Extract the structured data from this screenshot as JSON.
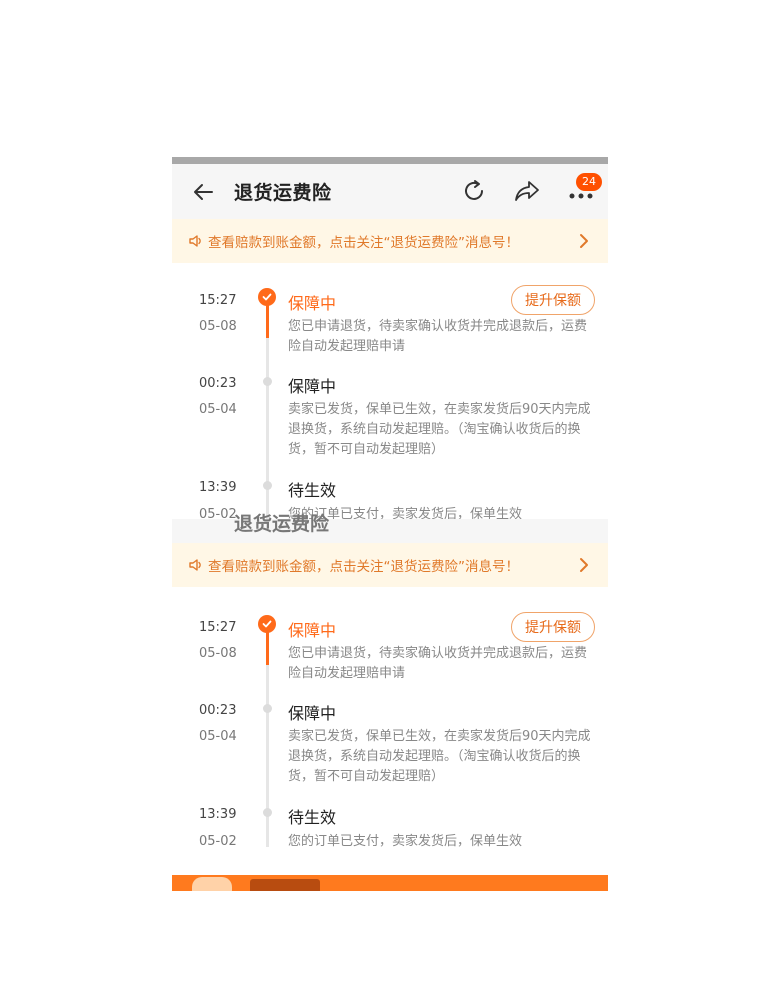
{
  "header": {
    "title": "退货运费险",
    "badge_count": "24",
    "ghost_title": "退货运费险"
  },
  "notice": {
    "text": "查看赔款到账金额，点击关注“退货运费险”消息号！"
  },
  "timeline": {
    "items": [
      {
        "time": "15:27",
        "date": "05-08",
        "status": "保障中",
        "desc": "您已申请退货，待卖家确认收货并完成退款后，运费险自动发起理赔申请",
        "action": "提升保额"
      },
      {
        "time": "00:23",
        "date": "05-04",
        "status": "保障中",
        "desc": "卖家已发货，保单已生效，在卖家发货后90天内完成退换货，系统自动发起理赔。（淘宝确认收货后的换货，暂不可自动发起理赔）"
      },
      {
        "time": "13:39",
        "date": "05-02",
        "status": "待生效",
        "desc": "您的订单已支付，卖家发货后，保单生效"
      }
    ]
  },
  "colors": {
    "accent": "#ff6a1a",
    "badge": "#ff5000",
    "notice_bg": "#fff7e6",
    "notice_text": "#e0792a"
  },
  "icons": [
    "back-arrow-icon",
    "refresh-icon",
    "share-icon",
    "more-icon",
    "speaker-icon",
    "chevron-right-icon",
    "check-icon"
  ]
}
